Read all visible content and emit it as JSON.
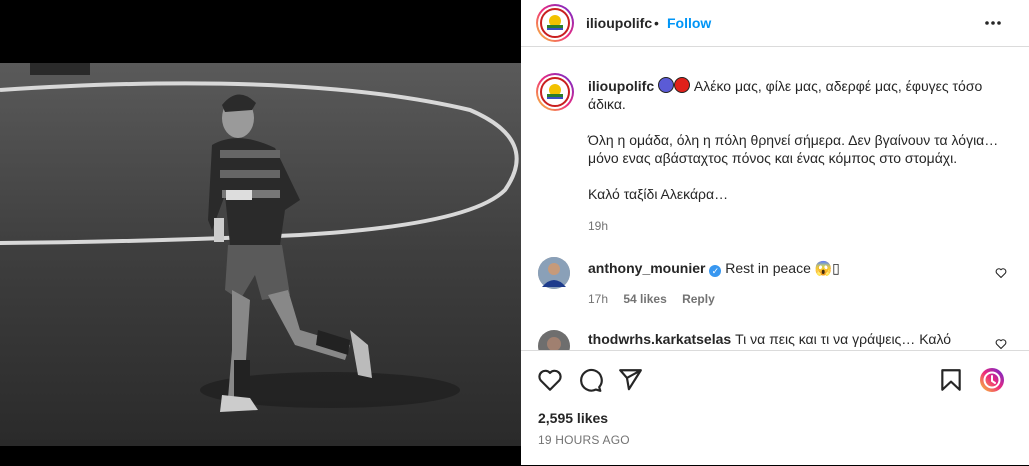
{
  "post": {
    "username": "ilioupolifc",
    "separator": "•",
    "follow_label": "Follow",
    "more_icon": "more-horizontal-icon",
    "caption_line1": "Αλέκο μας, φίλε μας, αδερφέ μας, έφυγες τόσο",
    "caption_line2": "άδικα.",
    "caption_para2_line1": "Όλη η ομάδα, όλη η πόλη θρηνεί σήμερα. Δεν βγαίνουν τα λόγια…",
    "caption_para2_line2": "μόνο ενας αβάσταχτος πόνος και ένας κόμπος στο στομάχι.",
    "caption_para3": "Καλό ταξίδι Αλεκάρα…",
    "caption_time": "19h",
    "likes": "2,595 likes",
    "time_ago": "19 HOURS AGO"
  },
  "comments": [
    {
      "username": "anthony_mounier",
      "verified": true,
      "text": "Rest in peace 😱▯",
      "time": "17h",
      "likes": "54 likes",
      "reply": "Reply"
    },
    {
      "username": "thodwrhs.karkatselas",
      "text": "Τι να πεις και τι να γράψεις… Καλό"
    }
  ],
  "colors": {
    "follow": "#0095f6",
    "jersey_blue": "#5b5bd6",
    "jersey_red": "#e0201a"
  }
}
